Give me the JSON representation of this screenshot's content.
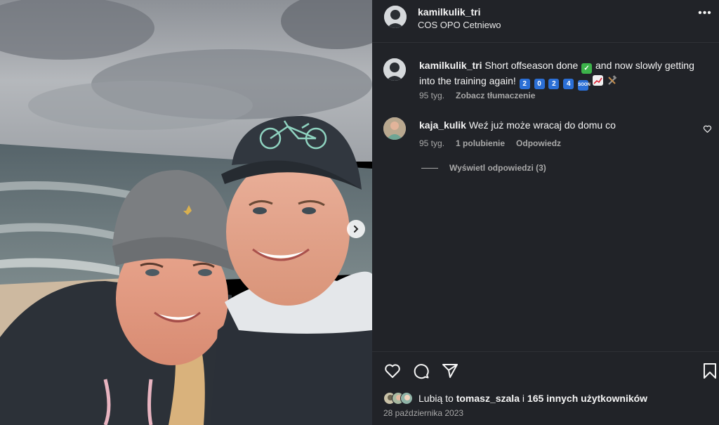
{
  "post": {
    "author": "kamilkulik_tri",
    "location": "COS OPO Cetniewo",
    "more_label": "•••"
  },
  "caption": {
    "user": "kamilkulik_tri",
    "text_before": "Short offseason done",
    "text_middle": "and now slowly getting into the training again!",
    "year_digits": [
      "2",
      "0",
      "2",
      "4"
    ],
    "soon_label": "SOON",
    "age": "95 tyg.",
    "translate": "Zobacz tłumaczenie"
  },
  "comments": [
    {
      "user": "kaja_kulik",
      "text": "Weź już może wracaj do domu co",
      "age": "95 tyg.",
      "likes": "1 polubienie",
      "reply": "Odpowiedz"
    }
  ],
  "view_replies": "Wyświetl odpowiedzi (3)",
  "likes_summary": {
    "prefix": "Lubią to",
    "user": "tomasz_szala",
    "connector": "i",
    "others": "165 innych użytkowników"
  },
  "post_date": "28 października 2023",
  "icons": {
    "like": "heart-icon",
    "comment": "comment-icon",
    "share": "share-icon",
    "save": "bookmark-icon",
    "next": "chevron-right-icon",
    "comment_like": "heart-icon"
  },
  "colors": {
    "panel_bg": "#212328",
    "text_primary": "#f5f5f5",
    "text_secondary": "#a8a8a8",
    "check_green": "#3cb34a",
    "keycap_blue": "#2b6fd6"
  }
}
